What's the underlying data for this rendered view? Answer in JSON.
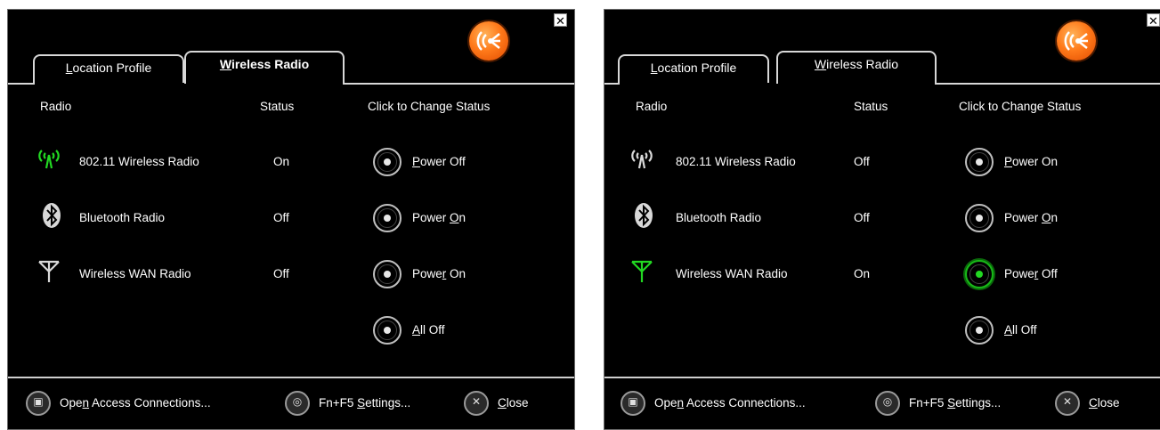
{
  "panels": [
    {
      "tabs": [
        {
          "pre": "",
          "u": "L",
          "post": "ocation Profile"
        },
        {
          "pre": "",
          "u": "W",
          "post": "ireless Radio"
        }
      ],
      "headers": {
        "radio": "Radio",
        "status": "Status",
        "change": "Click to Change Status"
      },
      "rows": [
        {
          "name": "802.11 Wireless Radio",
          "status": "On",
          "icon_color": "#22d822"
        },
        {
          "name": "Bluetooth Radio",
          "status": "Off",
          "icon_color": "#d8d8d8"
        },
        {
          "name": "Wireless WAN Radio",
          "status": "Off",
          "icon_color": "#d8d8d8"
        }
      ],
      "actions": [
        {
          "pre": "",
          "u": "P",
          "post": "ower Off"
        },
        {
          "pre": "Power ",
          "u": "O",
          "post": "n"
        },
        {
          "pre": "Powe",
          "u": "r",
          "post": " On"
        },
        {
          "pre": "",
          "u": "A",
          "post": "ll Off"
        }
      ],
      "buttons": {
        "open": {
          "pre": "Ope",
          "u": "n",
          "post": " Access Connections..."
        },
        "fn": {
          "pre": "Fn+F5 ",
          "u": "S",
          "post": "ettings..."
        },
        "close": {
          "pre": "",
          "u": "C",
          "post": "lose"
        }
      },
      "close_x": "✕"
    },
    {
      "tabs": [
        {
          "pre": "",
          "u": "L",
          "post": "ocation Profile"
        },
        {
          "pre": "",
          "u": "W",
          "post": "ireless Radio"
        }
      ],
      "headers": {
        "radio": "Radio",
        "status": "Status",
        "change": "Click to Change Status"
      },
      "rows": [
        {
          "name": "802.11 Wireless Radio",
          "status": "Off",
          "icon_color": "#d8d8d8"
        },
        {
          "name": "Bluetooth Radio",
          "status": "Off",
          "icon_color": "#d8d8d8"
        },
        {
          "name": "Wireless WAN Radio",
          "status": "On",
          "icon_color": "#22d822"
        }
      ],
      "actions": [
        {
          "pre": "",
          "u": "P",
          "post": "ower On"
        },
        {
          "pre": "Power ",
          "u": "O",
          "post": "n"
        },
        {
          "pre": "Powe",
          "u": "r",
          "post": " Off"
        },
        {
          "pre": "",
          "u": "A",
          "post": "ll Off"
        }
      ],
      "buttons": {
        "open": {
          "pre": "Ope",
          "u": "n",
          "post": " Access Connections..."
        },
        "fn": {
          "pre": "Fn+F5 ",
          "u": "S",
          "post": "ettings..."
        },
        "close": {
          "pre": "",
          "u": "C",
          "post": "lose"
        }
      },
      "close_x": "✕"
    }
  ]
}
